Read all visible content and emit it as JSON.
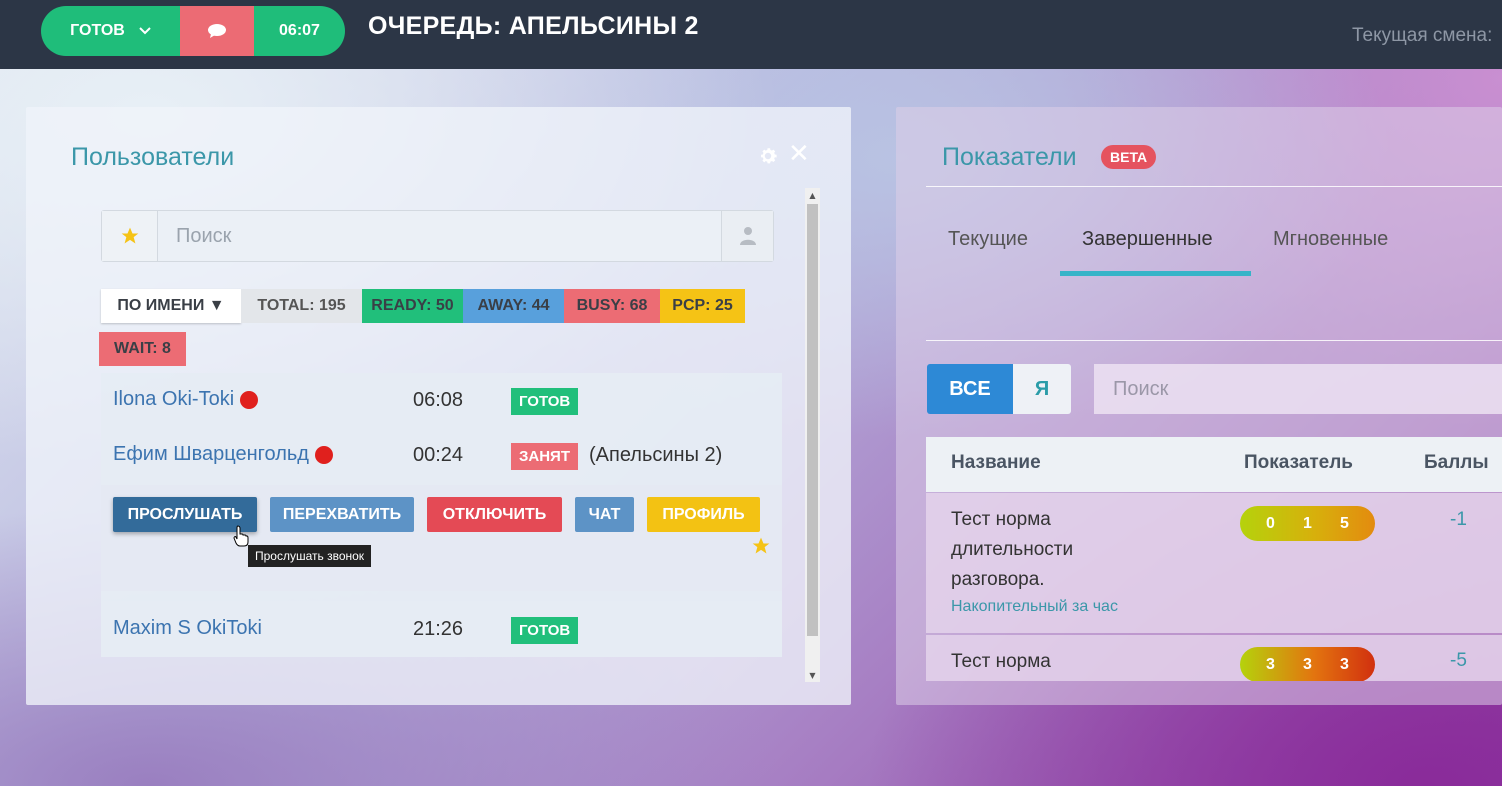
{
  "topbar": {
    "status_label": "ГОТОВ",
    "timer": "06:07",
    "queue_title": "ОЧЕРЕДЬ: АПЕЛЬСИНЫ 2",
    "shift_label": "Текущая смена: "
  },
  "users_panel": {
    "title": "Пользователи",
    "search_placeholder": "Поиск",
    "filters": {
      "sort": "ПО ИМЕНИ ▼",
      "total": "TOTAL: 195",
      "ready": "READY: 50",
      "away": "AWAY: 44",
      "busy": "BUSY: 68",
      "pcp": "PCP: 25",
      "wait": "WAIT: 8"
    },
    "rows": [
      {
        "name": "Ilona Oki-Toki",
        "time": "06:08",
        "status": "ГОТОВ",
        "queue": ""
      },
      {
        "name": "Ефим Шварценгольд",
        "time": "00:24",
        "status": "ЗАНЯТ",
        "queue": "(Апельсины 2)"
      },
      {
        "name": "Maxim S OkiToki",
        "time": "21:26",
        "status": "ГОТОВ",
        "queue": ""
      }
    ],
    "actions": {
      "listen": "ПРОСЛУШАТЬ",
      "intercept": "ПЕРЕХВАТИТЬ",
      "disconnect": "ОТКЛЮЧИТЬ",
      "chat": "ЧАТ",
      "profile": "ПРОФИЛЬ",
      "tooltip": "Прослушать звонок"
    }
  },
  "metrics_panel": {
    "title": "Показатели",
    "badge": "BETA",
    "tabs": [
      "Текущие",
      "Завершенные",
      "Мгновенные"
    ],
    "active_tab": "Завершенные",
    "segment": {
      "all": "ВСЕ",
      "me": "Я"
    },
    "search_placeholder": "Поиск",
    "columns": {
      "name": "Название",
      "metric": "Показатель",
      "score": "Баллы"
    },
    "rows": [
      {
        "name": "Тест норма длительности разговора.",
        "sub": "Накопительный за час",
        "values": [
          "0",
          "1",
          "5"
        ],
        "score": "-1"
      },
      {
        "name": "Тест норма",
        "sub": "",
        "values": [
          "3",
          "3",
          "3"
        ],
        "score": "-5"
      }
    ]
  },
  "colors": {
    "topbar": "#2c3646",
    "ready": "#1fbd7a",
    "busy": "#ec6c74",
    "away": "#58a0dc",
    "pcp": "#f5c315",
    "accent": "#3b97a9"
  },
  "icons": [
    "chevron-down-icon",
    "chat-bubble-icon",
    "gear-icon",
    "close-icon",
    "star-icon",
    "user-icon",
    "hand-cursor-icon"
  ]
}
